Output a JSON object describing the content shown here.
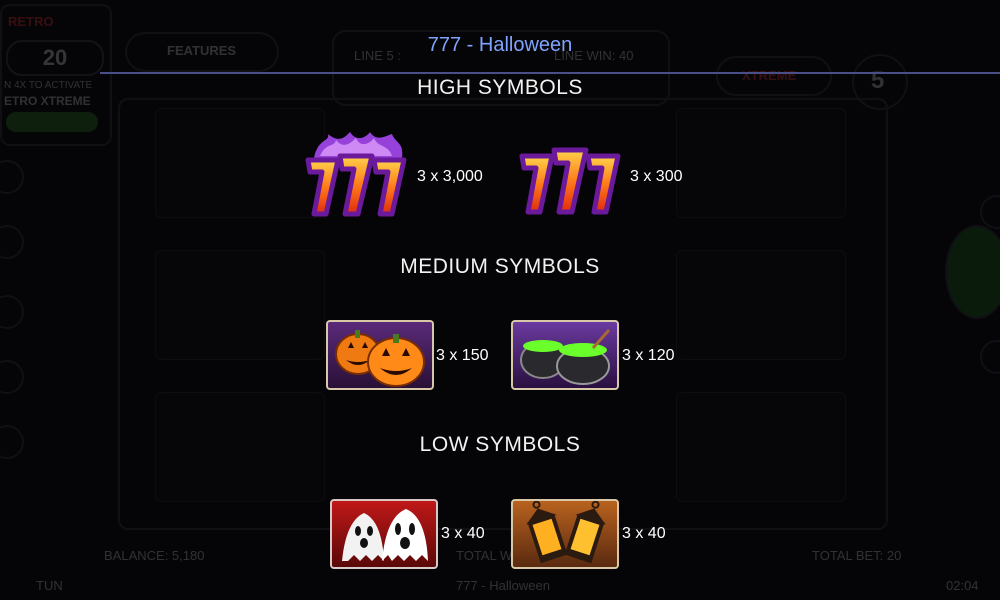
{
  "background": {
    "retro_label": "RETRO",
    "counter": "20",
    "activate_text_1": "N 4X TO ACTIVATE",
    "activate_text_2": "ETRO XTREME",
    "features_label": "FEATURES",
    "line_label": "LINE 5 :",
    "line_win_label": "LINE WIN: 40",
    "xtreme_label": "XTREME",
    "round_value": "5",
    "balance": "BALANCE: 5,180",
    "total_win": "TOTAL W",
    "total_bet": "TOTAL BET: 20",
    "footer_left": "TUN",
    "footer_center": "777 - Halloween",
    "footer_time": "02:04"
  },
  "title": "777 - Halloween",
  "sections": {
    "high": "HIGH SYMBOLS",
    "medium": "MEDIUM SYMBOLS",
    "low": "LOW SYMBOLS"
  },
  "symbols": {
    "sevens_fire": {
      "icon": "triple-seven-fire-icon",
      "payout": "3 x 3,000"
    },
    "sevens": {
      "icon": "triple-seven-icon",
      "payout": "3 x 300"
    },
    "pumpkins": {
      "icon": "pumpkins-icon",
      "payout": "3 x 150"
    },
    "cauldrons": {
      "icon": "cauldrons-icon",
      "payout": "3 x 120"
    },
    "ghosts": {
      "icon": "ghosts-icon",
      "payout": "3 x 40"
    },
    "lanterns": {
      "icon": "lanterns-icon",
      "payout": "3 x 40"
    }
  },
  "colors": {
    "title": "#7fa3ff",
    "divider": "#4a4f8a"
  }
}
